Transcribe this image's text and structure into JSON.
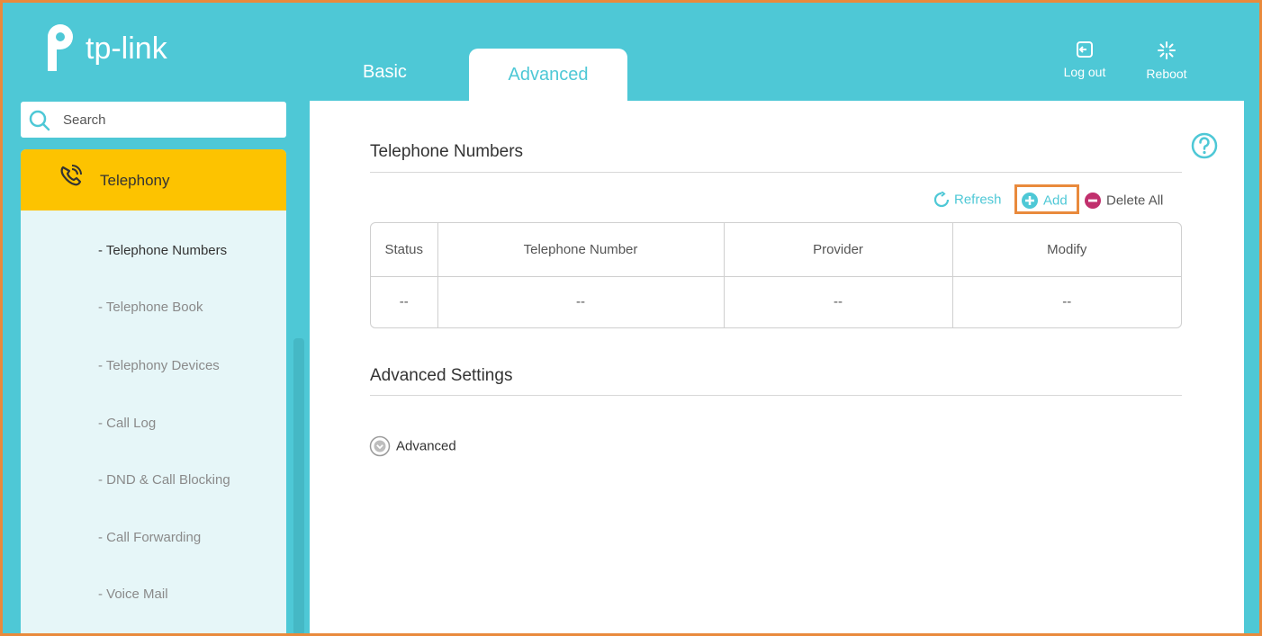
{
  "brand": {
    "name": "tp-link"
  },
  "header": {
    "tabs": [
      {
        "label": "Basic"
      },
      {
        "label": "Advanced"
      }
    ],
    "logout_label": "Log out",
    "reboot_label": "Reboot"
  },
  "sidebar": {
    "search_placeholder": "Search",
    "section": {
      "label": "Telephony",
      "icon": "phone-icon"
    },
    "items": [
      {
        "label": "- Telephone Numbers"
      },
      {
        "label": "- Telephone Book"
      },
      {
        "label": "- Telephony Devices"
      },
      {
        "label": "- Call Log"
      },
      {
        "label": "- DND & Call Blocking"
      },
      {
        "label": "- Call Forwarding"
      },
      {
        "label": "- Voice Mail"
      }
    ]
  },
  "main": {
    "telephone_numbers": {
      "title": "Telephone Numbers",
      "actions": {
        "refresh": "Refresh",
        "add": "Add",
        "delete_all": "Delete All"
      },
      "table": {
        "headers": [
          "Status",
          "Telephone Number",
          "Provider",
          "Modify"
        ],
        "rows": [
          [
            "--",
            "--",
            "--",
            "--"
          ]
        ]
      }
    },
    "advanced_settings": {
      "title": "Advanced Settings",
      "toggle_label": "Advanced"
    }
  },
  "colors": {
    "accent": "#4ec8d6",
    "active_nav": "#fdc300",
    "highlight": "#e98a3c",
    "delete": "#c1306d"
  }
}
